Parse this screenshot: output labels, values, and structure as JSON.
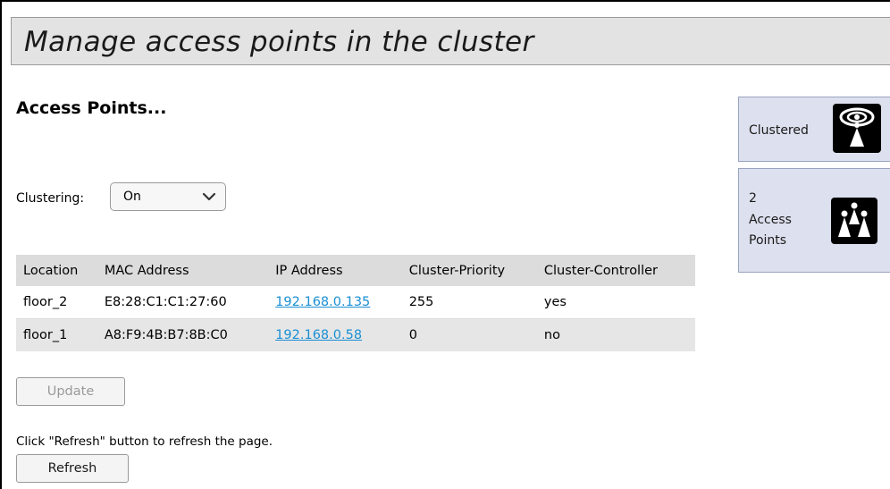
{
  "page": {
    "title": "Manage access points in the cluster",
    "section_heading": "Access Points..."
  },
  "clustering": {
    "label": "Clustering:",
    "selected": "On"
  },
  "table": {
    "headers": [
      "Location",
      "MAC Address",
      "IP Address",
      "Cluster-Priority",
      "Cluster-Controller"
    ],
    "rows": [
      {
        "location": "floor_2",
        "mac": "E8:28:C1:C1:27:60",
        "ip": "192.168.0.135",
        "priority": "255",
        "controller": "yes"
      },
      {
        "location": "floor_1",
        "mac": "A8:F9:4B:B7:8B:C0",
        "ip": "192.168.0.58",
        "priority": "0",
        "controller": "no"
      }
    ]
  },
  "buttons": {
    "update": "Update",
    "refresh": "Refresh"
  },
  "refresh_hint": "Click \"Refresh\" button to refresh the page.",
  "status": {
    "clustered_label": "Clustered",
    "clustered_icon": "clustered-ap-icon",
    "ap_count": "2",
    "ap_label_line1": "Access",
    "ap_label_line2": "Points",
    "ap_icon": "access-points-icon"
  },
  "colors": {
    "link": "#1a8fd4",
    "title_bar": "#e3e3e3",
    "status_panel": "#dde0ee"
  }
}
